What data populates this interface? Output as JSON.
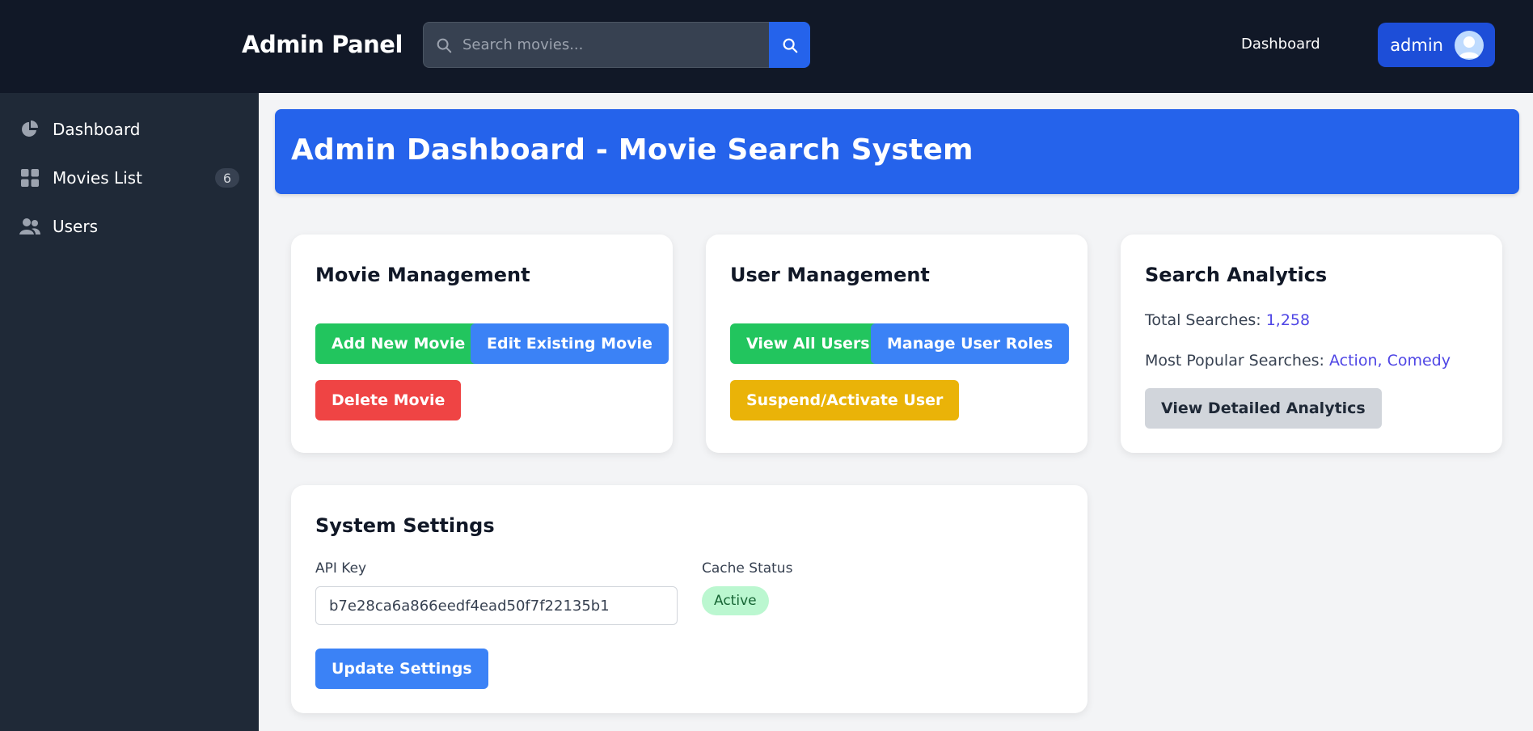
{
  "header": {
    "brand": "Admin Panel",
    "search_placeholder": "Search movies...",
    "nav_dashboard": "Dashboard",
    "user_label": "admin"
  },
  "sidebar": {
    "items": [
      {
        "label": "Dashboard",
        "icon": "pie-chart-icon"
      },
      {
        "label": "Movies List",
        "icon": "grid-icon",
        "count": "6"
      },
      {
        "label": "Users",
        "icon": "users-icon"
      }
    ]
  },
  "main": {
    "title": "Admin Dashboard - Movie Search System",
    "movie_management": {
      "title": "Movie Management",
      "add": "Add New Movie",
      "edit": "Edit Existing Movie",
      "delete": "Delete Movie"
    },
    "user_management": {
      "title": "User Management",
      "view_all": "View All Users",
      "manage_roles": "Manage User Roles",
      "suspend": "Suspend/Activate User"
    },
    "search_analytics": {
      "title": "Search Analytics",
      "total_label": "Total Searches: ",
      "total_value": "1,258",
      "popular_label": "Most Popular Searches: ",
      "popular_value": "Action, Comedy",
      "details_button": "View Detailed Analytics"
    },
    "system_settings": {
      "title": "System Settings",
      "api_key_label": "API Key",
      "api_key_value": "b7e28ca6a866eedf4ead50f7f22135b1",
      "cache_label": "Cache Status",
      "cache_value": "Active",
      "update_button": "Update Settings"
    }
  },
  "colors": {
    "topbar": "#111827",
    "sidebar": "#1f2937",
    "primary": "#2563eb",
    "success": "#22c55e",
    "danger": "#ef4444",
    "warning": "#eab308"
  }
}
